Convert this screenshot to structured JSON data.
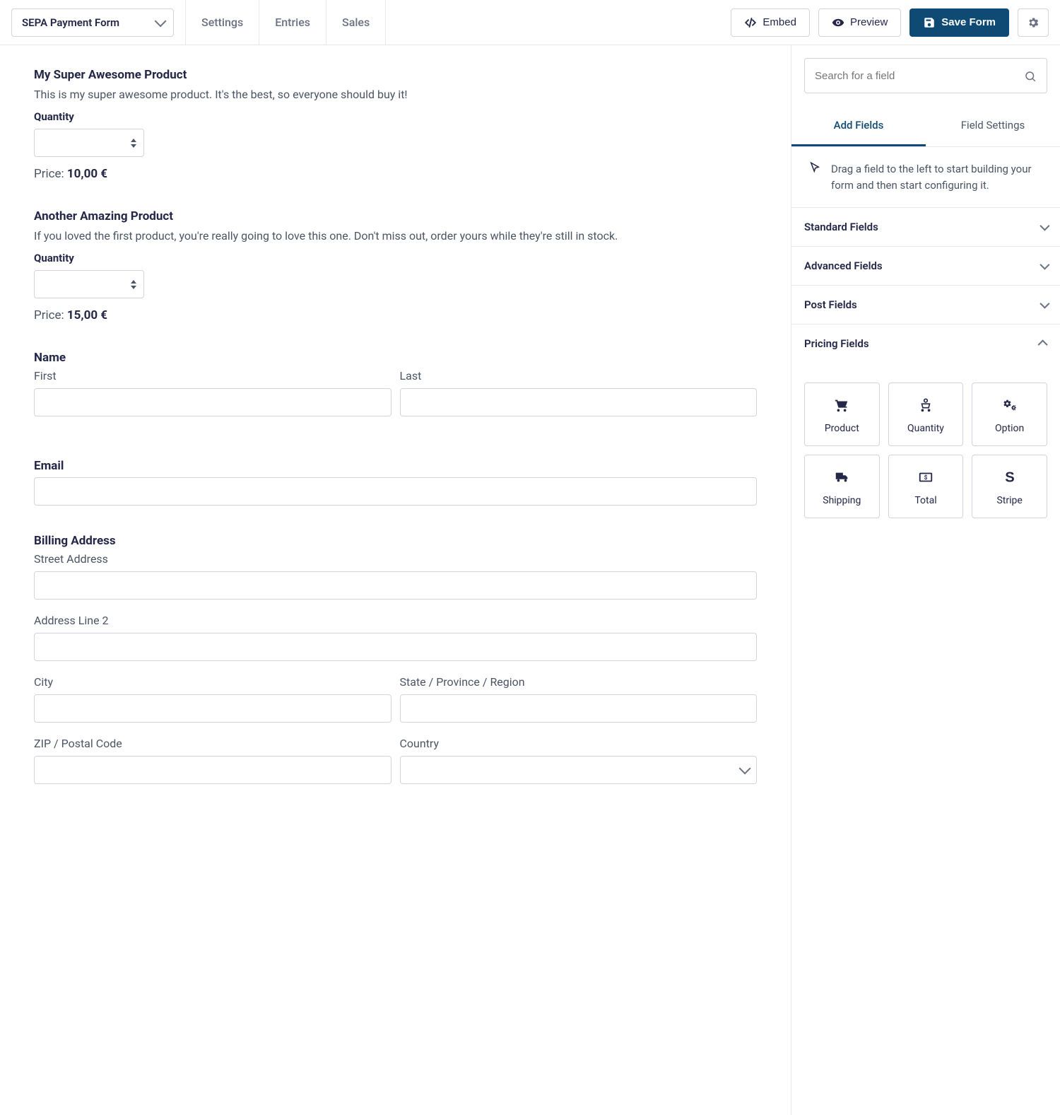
{
  "toolbar": {
    "form_selector": "SEPA Payment Form",
    "nav": [
      "Settings",
      "Entries",
      "Sales"
    ],
    "embed": "Embed",
    "preview": "Preview",
    "save": "Save Form"
  },
  "form": {
    "product1": {
      "title": "My Super Awesome Product",
      "desc": "This is my super awesome product. It's the best, so everyone should buy it!",
      "qty_label": "Quantity",
      "price_label": "Price:",
      "price_value": "10,00 €"
    },
    "product2": {
      "title": "Another Amazing Product",
      "desc": "If you loved the first product, you're really going to love this one. Don't miss out, order yours while they're still in stock.",
      "qty_label": "Quantity",
      "price_label": "Price:",
      "price_value": "15,00 €"
    },
    "name": {
      "label": "Name",
      "first": "First",
      "last": "Last"
    },
    "email": {
      "label": "Email"
    },
    "billing": {
      "label": "Billing Address",
      "street": "Street Address",
      "line2": "Address Line 2",
      "city": "City",
      "state": "State / Province / Region",
      "zip": "ZIP / Postal Code",
      "country": "Country"
    }
  },
  "panel": {
    "search_placeholder": "Search for a field",
    "tabs": {
      "add": "Add Fields",
      "settings": "Field Settings"
    },
    "hint": "Drag a field to the left to start building your form and then start configuring it.",
    "accordions": {
      "standard": "Standard Fields",
      "advanced": "Advanced Fields",
      "post": "Post Fields",
      "pricing": "Pricing Fields"
    },
    "pricing_fields": [
      "Product",
      "Quantity",
      "Option",
      "Shipping",
      "Total",
      "Stripe"
    ]
  }
}
